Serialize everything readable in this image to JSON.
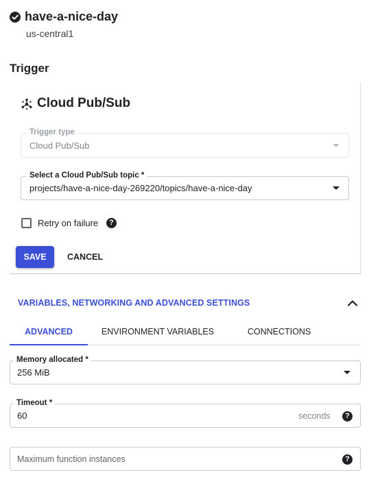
{
  "function": {
    "name": "have-a-nice-day",
    "region": "us-central1",
    "status_icon": "check-circle-icon"
  },
  "trigger_section": {
    "title": "Trigger",
    "card_title": "Cloud Pub/Sub",
    "card_icon": "pubsub-icon",
    "trigger_type": {
      "label": "Trigger type",
      "value": "Cloud Pub/Sub",
      "disabled": true
    },
    "topic": {
      "label": "Select a Cloud Pub/Sub topic *",
      "value": "projects/have-a-nice-day-269220/topics/have-a-nice-day"
    },
    "retry": {
      "label": "Retry on failure",
      "checked": false
    },
    "save_label": "SAVE",
    "cancel_label": "CANCEL"
  },
  "advanced_section": {
    "title": "VARIABLES, NETWORKING AND ADVANCED SETTINGS",
    "expanded": true,
    "tabs": [
      {
        "label": "ADVANCED",
        "active": true
      },
      {
        "label": "ENVIRONMENT VARIABLES",
        "active": false
      },
      {
        "label": "CONNECTIONS",
        "active": false
      }
    ],
    "memory": {
      "label": "Memory allocated *",
      "value": "256 MiB"
    },
    "timeout": {
      "label": "Timeout *",
      "value": "60",
      "suffix": "seconds"
    },
    "max_instances": {
      "placeholder": "Maximum function instances"
    }
  },
  "colors": {
    "accent": "#3b4ed8",
    "text": "#202124",
    "muted": "#80868b",
    "border": "#c8cacd"
  }
}
